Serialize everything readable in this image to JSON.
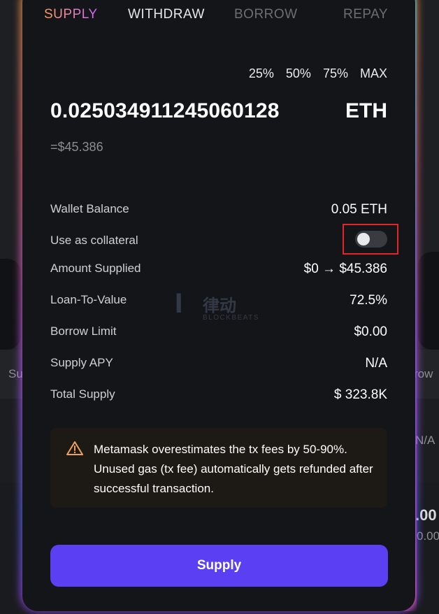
{
  "background": {
    "left_label": "Su",
    "right_label": "row",
    "right_value_1": "N/A",
    "right_value_2": ".00",
    "right_value_3": "0.00"
  },
  "tabs": [
    {
      "label": "SUPPLY",
      "active": true
    },
    {
      "label": "WITHDRAW",
      "active": false
    },
    {
      "label": "BORROW",
      "active": false
    },
    {
      "label": "REPAY",
      "active": false
    }
  ],
  "amount_input": {
    "percent_options": [
      "25%",
      "50%",
      "75%",
      "MAX"
    ],
    "value": "0.025034911245060128",
    "asset": "ETH",
    "usd_value": "=$45.386"
  },
  "details": {
    "wallet_balance": {
      "label": "Wallet Balance",
      "value": "0.05 ETH"
    },
    "collateral": {
      "label": "Use as collateral",
      "enabled": false
    },
    "amount_supplied": {
      "label": "Amount Supplied",
      "value": "$0 → $45.386"
    },
    "ltv": {
      "label": "Loan-To-Value",
      "value": "72.5%"
    },
    "borrow_limit": {
      "label": "Borrow Limit",
      "value": "$0.00"
    },
    "supply_apy": {
      "label": "Supply APY",
      "value": "N/A"
    },
    "total_supply": {
      "label": "Total Supply",
      "value": "$ 323.8K"
    }
  },
  "watermark": {
    "cn_text": "律动",
    "en_text": "BLOCKBEATS"
  },
  "warning": {
    "icon": "warning-triangle-icon",
    "text": "Metamask overestimates the tx fees by 50-90%. Unused gas (tx fee) automatically gets refunded after successful transaction."
  },
  "action": {
    "supply_label": "Supply"
  },
  "colors": {
    "accent": "#5b3ff2",
    "tab_active_start": "#ff9d5c",
    "tab_active_end": "#c966ff",
    "highlight": "#e3252a",
    "warning_icon": "#f0a05a"
  }
}
